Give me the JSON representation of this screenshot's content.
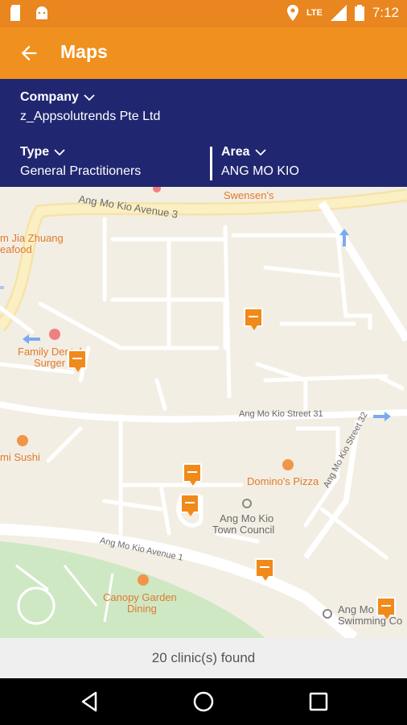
{
  "status_bar": {
    "time": "7:12",
    "network": "LTE",
    "icons": [
      "sd-card-icon",
      "android-icon",
      "location-icon",
      "signal-icon",
      "battery-icon"
    ]
  },
  "app_bar": {
    "title": "Maps",
    "back_icon": "arrow-back-icon"
  },
  "filters": {
    "company": {
      "label": "Company",
      "value": "z_Appsolutrends Pte Ltd"
    },
    "type": {
      "label": "Type",
      "value": "General Practitioners"
    },
    "area": {
      "label": "Area",
      "value": "ANG MO KIO"
    }
  },
  "map": {
    "labels": {
      "avenue3": "Ang Mo Kio Avenue 3",
      "swensens": "Swensen's",
      "jia_zhuang": "m Jia Zhuang",
      "seafood": "eafood",
      "family_dental": "Family Dental",
      "surgery": "Surger",
      "street31": "Ang Mo Kio Street 31",
      "sushi": "mi Sushi",
      "dominos": "Domino's Pizza",
      "town_council_1": "Ang Mo Kio",
      "town_council_2": "Town Council",
      "street32": "Ang Mo Kio Street 32",
      "avenue1": "Ang Mo Kio Avenue 1",
      "canopy_1": "Canopy Garden",
      "canopy_2": "Dining",
      "swimming_1": "Ang Mo",
      "swimming_2": "Swimming Co"
    },
    "clinic_markers": 6
  },
  "footer": {
    "result_text": "20 clinic(s) found"
  },
  "nav_bar": {
    "buttons": [
      "back-nav-icon",
      "home-nav-icon",
      "recents-nav-icon"
    ]
  },
  "colors": {
    "status": "#E9861F",
    "appbar": "#F0901E",
    "filters_bg": "#202670",
    "marker": "#F08A1A",
    "park": "#CFE8C4"
  }
}
